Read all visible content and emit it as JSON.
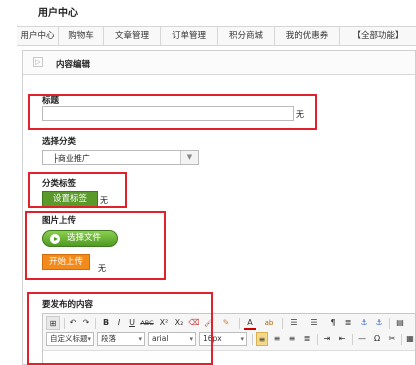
{
  "page": {
    "title": "用户中心"
  },
  "tabs": [
    {
      "label": "用户中心"
    },
    {
      "label": "购物车"
    },
    {
      "label": "文章管理"
    },
    {
      "label": "订单管理"
    },
    {
      "label": "积分商城"
    },
    {
      "label": "我的优惠券"
    },
    {
      "label": "【全部功能】"
    }
  ],
  "panel": {
    "title": "内容编辑"
  },
  "form": {
    "title_label": "标题",
    "title_value": "",
    "title_suffix": "无",
    "category_label": "选择分类",
    "category_value": "├商业推广",
    "tag_label": "分类标签",
    "tag_button": "设置标签",
    "tag_suffix": "无",
    "image_label": "图片上传",
    "choose_file_button": "选择文件",
    "start_upload_button": "开始上传",
    "upload_suffix": "无",
    "content_label": "要发布的内容"
  },
  "editor": {
    "toolbar_row1": [
      "↶",
      "↷",
      "B",
      "I",
      "U",
      "ABC",
      "X²",
      "X₂",
      "⌫",
      "🖌",
      "✎",
      "A",
      "ab",
      "☰",
      "☰",
      "¶",
      "≣",
      "⚓",
      "⚓"
    ],
    "format_select": "自定义标题",
    "paragraph_select": "段落",
    "font_select": "arial",
    "size_select": "16px"
  },
  "colors": {
    "highlight": "#e0222a",
    "green_button": "#5a9a2a",
    "orange_button": "#f28a1c"
  }
}
